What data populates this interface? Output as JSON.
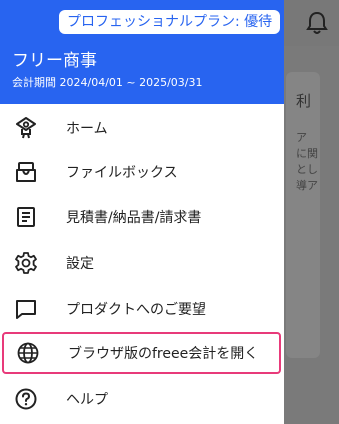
{
  "background": {
    "card_title": "利",
    "card_text": "ア に関 とし 導ア"
  },
  "drawer": {
    "plan_badge": "プロフェッショナルプラン: 優待",
    "company_name": "フリー商事",
    "fiscal_period": "会計期間 2024/04/01 ~ 2025/03/31",
    "menu": [
      {
        "label": "ホーム",
        "icon": "home-robot-icon"
      },
      {
        "label": "ファイルボックス",
        "icon": "file-box-icon"
      },
      {
        "label": "見積書/納品書/請求書",
        "icon": "invoice-icon"
      },
      {
        "label": "設定",
        "icon": "gear-icon"
      },
      {
        "label": "プロダクトへのご要望",
        "icon": "feedback-icon"
      },
      {
        "label": "ブラウザ版のfreee会計を開く",
        "icon": "globe-icon",
        "selected": true
      },
      {
        "label": "ヘルプ",
        "icon": "help-icon"
      }
    ]
  },
  "colors": {
    "brand": "#2864f0",
    "highlight": "#e83a7a",
    "scrim": "#7a7a7a"
  }
}
